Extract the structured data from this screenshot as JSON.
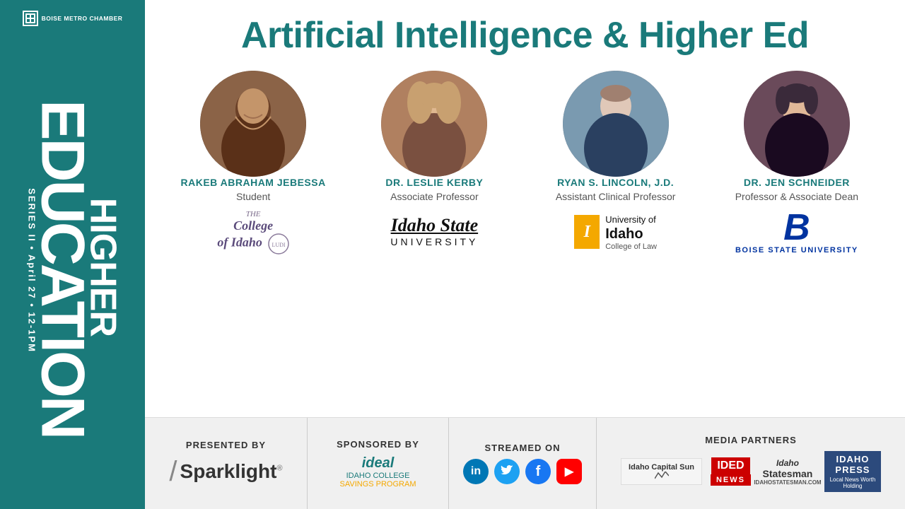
{
  "sidebar": {
    "org_line1": "BOISE METRO CHAMBER",
    "series_label": "HIGHER",
    "series_word": "EDUCATION",
    "series_info": "SERIES II • April 27 • 12-1PM"
  },
  "main": {
    "event_title": "Artificial Intelligence & Higher Ed",
    "speakers": [
      {
        "id": "rakeb",
        "name": "RAKEB ABRAHAM JEBESSA",
        "role": "Student",
        "org": "The College of Idaho",
        "org_type": "college-idaho"
      },
      {
        "id": "leslie",
        "name": "DR. LESLIE KERBY",
        "role": "Associate Professor",
        "org": "Idaho State University",
        "org_type": "idaho-state"
      },
      {
        "id": "ryan",
        "name": "RYAN S. LINCOLN, J.D.",
        "role": "Assistant Clinical Professor",
        "org": "University of Idaho College of Law",
        "org_type": "u-idaho"
      },
      {
        "id": "jen",
        "name": "DR. JEN SCHNEIDER",
        "role": "Professor & Associate Dean",
        "org": "Boise State University",
        "org_type": "boise-state"
      }
    ]
  },
  "footer": {
    "presented_by_label": "PRESENTED BY",
    "presented_by_logo": "Sparklight",
    "sponsored_by_label": "SPONSORED BY",
    "sponsored_by_logo": "ideal IDAHO COLLEGE SAVINGS PROGRAM",
    "streamed_on_label": "STREAMED ON",
    "media_partners_label": "MEDIA PARTNERS",
    "media_partners": [
      "Idaho Capital Sun",
      "IDED NEWS",
      "Idaho Statesman",
      "IDAHO PRESS"
    ]
  },
  "social_icons": {
    "linkedin": "in",
    "twitter": "t",
    "facebook": "f",
    "youtube": "▶"
  }
}
